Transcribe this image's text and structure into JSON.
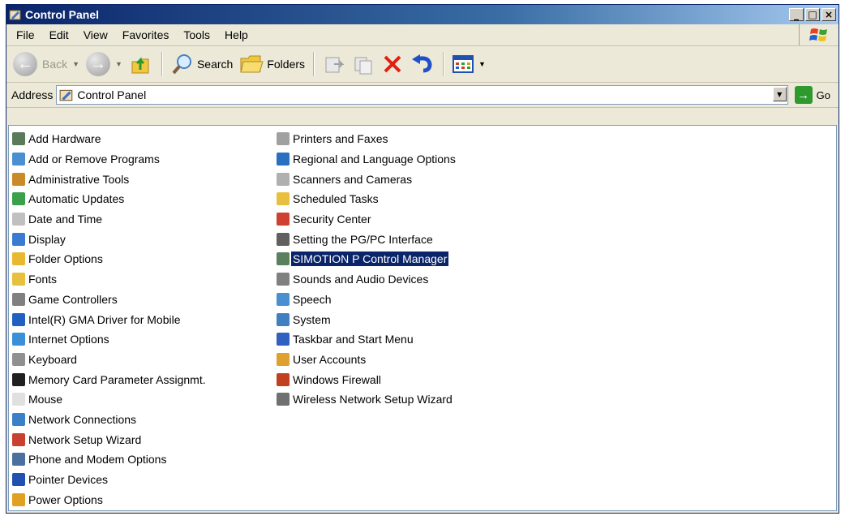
{
  "window": {
    "title": "Control Panel"
  },
  "menubar": [
    "File",
    "Edit",
    "View",
    "Favorites",
    "Tools",
    "Help"
  ],
  "toolbar": {
    "back_label": "Back",
    "search_label": "Search",
    "folders_label": "Folders"
  },
  "address": {
    "label": "Address",
    "value": "Control Panel",
    "go_label": "Go"
  },
  "items_col1": [
    {
      "label": "Add Hardware",
      "icon": "hardware-icon",
      "color": "#5a7a5a"
    },
    {
      "label": "Add or Remove Programs",
      "icon": "programs-icon",
      "color": "#4a8fd0"
    },
    {
      "label": "Administrative Tools",
      "icon": "admin-tools-icon",
      "color": "#c98a2a"
    },
    {
      "label": "Automatic Updates",
      "icon": "updates-icon",
      "color": "#3aa04a"
    },
    {
      "label": "Date and Time",
      "icon": "clock-icon",
      "color": "#c0c0c0"
    },
    {
      "label": "Display",
      "icon": "display-icon",
      "color": "#3a7ad0"
    },
    {
      "label": "Folder Options",
      "icon": "folder-options-icon",
      "color": "#e8b830"
    },
    {
      "label": "Fonts",
      "icon": "fonts-icon",
      "color": "#e8c040"
    },
    {
      "label": "Game Controllers",
      "icon": "gamepad-icon",
      "color": "#808080"
    },
    {
      "label": "Intel(R) GMA Driver for Mobile",
      "icon": "intel-icon",
      "color": "#2060c0"
    },
    {
      "label": "Internet Options",
      "icon": "internet-icon",
      "color": "#3a90d8"
    },
    {
      "label": "Keyboard",
      "icon": "keyboard-icon",
      "color": "#909090"
    },
    {
      "label": "Memory Card Parameter Assignmt.",
      "icon": "memory-card-icon",
      "color": "#202020"
    },
    {
      "label": "Mouse",
      "icon": "mouse-icon",
      "color": "#e0e0e0"
    },
    {
      "label": "Network Connections",
      "icon": "network-icon",
      "color": "#3a80c8"
    },
    {
      "label": "Network Setup Wizard",
      "icon": "network-wizard-icon",
      "color": "#c84030"
    },
    {
      "label": "Phone and Modem Options",
      "icon": "phone-icon",
      "color": "#4a70a0"
    },
    {
      "label": "Pointer Devices",
      "icon": "pointer-icon",
      "color": "#2050b0"
    },
    {
      "label": "Power Options",
      "icon": "power-icon",
      "color": "#e0a020"
    }
  ],
  "items_col2": [
    {
      "label": "Printers and Faxes",
      "icon": "printer-icon",
      "color": "#a0a0a0"
    },
    {
      "label": "Regional and Language Options",
      "icon": "globe-icon",
      "color": "#2a70c0"
    },
    {
      "label": "Scanners and Cameras",
      "icon": "scanner-icon",
      "color": "#b0b0b0"
    },
    {
      "label": "Scheduled Tasks",
      "icon": "tasks-icon",
      "color": "#e8c040"
    },
    {
      "label": "Security Center",
      "icon": "shield-icon",
      "color": "#d04030"
    },
    {
      "label": "Setting the PG/PC Interface",
      "icon": "pgpc-icon",
      "color": "#606060"
    },
    {
      "label": "SIMOTION P Control Manager",
      "icon": "simotion-icon",
      "color": "#5a8060",
      "selected": true
    },
    {
      "label": "Sounds and Audio Devices",
      "icon": "speaker-icon",
      "color": "#808080"
    },
    {
      "label": "Speech",
      "icon": "speech-icon",
      "color": "#4a90d0"
    },
    {
      "label": "System",
      "icon": "system-icon",
      "color": "#4080c0"
    },
    {
      "label": "Taskbar and Start Menu",
      "icon": "taskbar-icon",
      "color": "#3060c0"
    },
    {
      "label": "User Accounts",
      "icon": "users-icon",
      "color": "#e0a030"
    },
    {
      "label": "Windows Firewall",
      "icon": "firewall-icon",
      "color": "#c04020"
    },
    {
      "label": "Wireless Network Setup Wizard",
      "icon": "wireless-icon",
      "color": "#707070"
    }
  ]
}
